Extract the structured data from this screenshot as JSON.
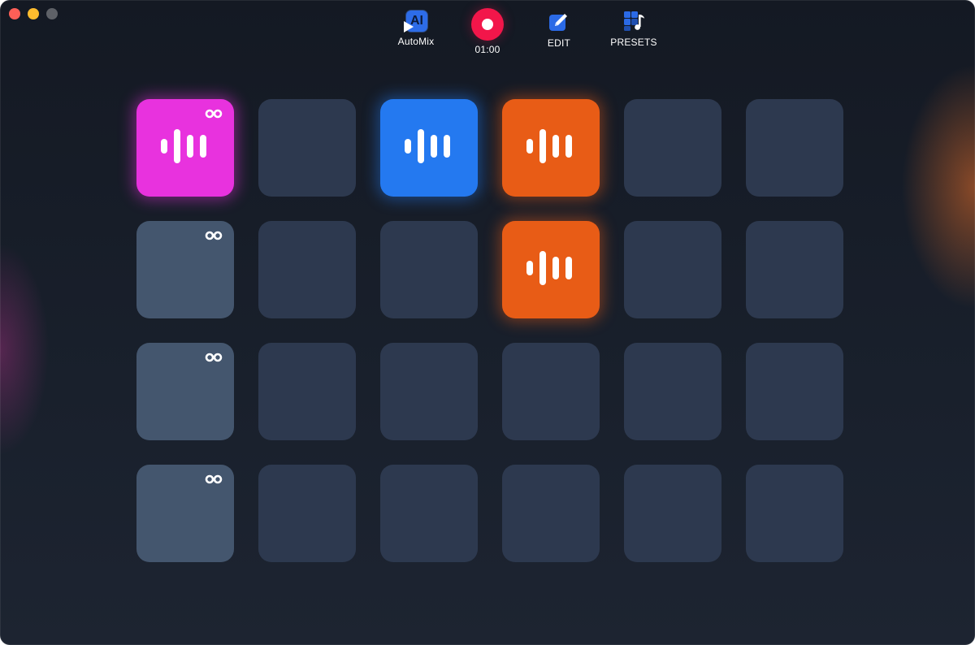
{
  "toolbar": {
    "automix": {
      "badge": "AI",
      "label": "AutoMix",
      "icon": "ai-play-icon"
    },
    "record": {
      "time": "01:00",
      "icon": "record-icon",
      "color": "#f2164a"
    },
    "edit": {
      "label": "EDIT",
      "icon": "pencil-square-icon"
    },
    "presets": {
      "label": "PRESETS",
      "icon": "grid-music-note-icon"
    }
  },
  "colors": {
    "magenta": "#e832de",
    "blue": "#2479f0",
    "orange": "#e85c16",
    "empty_pad": "#2d394f",
    "loop_slot": "#44566e"
  },
  "grid": {
    "rows": 4,
    "columns": 6,
    "pads": [
      [
        {
          "state": "active",
          "color": "magenta",
          "loop": true
        },
        {
          "state": "empty"
        },
        {
          "state": "active",
          "color": "blue"
        },
        {
          "state": "active",
          "color": "orange"
        },
        {
          "state": "empty"
        },
        {
          "state": "empty"
        }
      ],
      [
        {
          "state": "loop-slot",
          "loop": true
        },
        {
          "state": "empty"
        },
        {
          "state": "empty"
        },
        {
          "state": "active",
          "color": "orange"
        },
        {
          "state": "empty"
        },
        {
          "state": "empty"
        }
      ],
      [
        {
          "state": "loop-slot",
          "loop": true
        },
        {
          "state": "empty"
        },
        {
          "state": "empty"
        },
        {
          "state": "empty"
        },
        {
          "state": "empty"
        },
        {
          "state": "empty"
        }
      ],
      [
        {
          "state": "loop-slot",
          "loop": true
        },
        {
          "state": "empty"
        },
        {
          "state": "empty"
        },
        {
          "state": "empty"
        },
        {
          "state": "empty"
        },
        {
          "state": "empty"
        }
      ]
    ]
  }
}
